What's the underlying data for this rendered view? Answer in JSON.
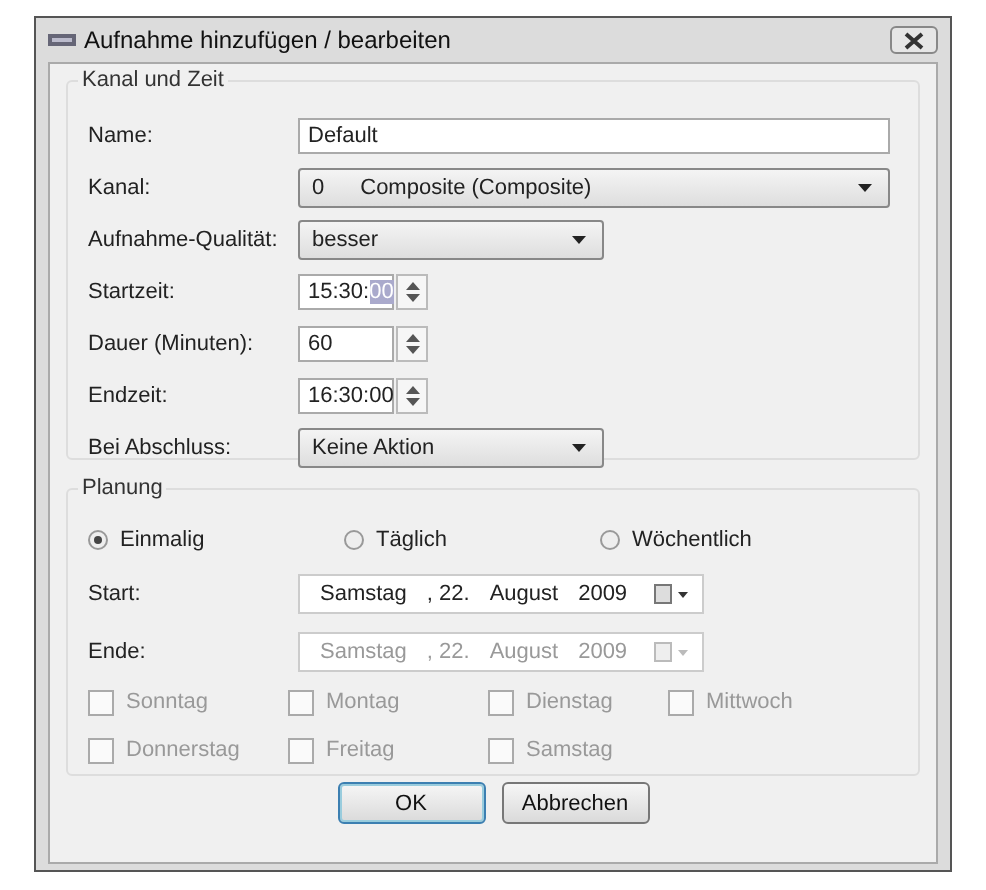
{
  "window": {
    "title": "Aufnahme hinzufügen / bearbeiten"
  },
  "channel_group": {
    "title": "Kanal und Zeit",
    "fields": [
      {
        "label": "Name:",
        "kind": "text",
        "value": "Default"
      },
      {
        "label": "Kanal:",
        "kind": "combo",
        "wide": true,
        "parts": [
          "0",
          "Composite  (Composite)"
        ]
      },
      {
        "label": "Aufnahme-Qualität:",
        "kind": "combo",
        "wide": false,
        "parts": [
          "besser"
        ]
      },
      {
        "label": "Startzeit:",
        "kind": "spin",
        "value": "15:30:",
        "highlighted": "00"
      },
      {
        "label": "Dauer (Minuten):",
        "kind": "spin",
        "value": "60"
      },
      {
        "label": "Endzeit:",
        "kind": "spin",
        "value": "16:30:00"
      },
      {
        "label": "Bei Abschluss:",
        "kind": "combo",
        "wide": false,
        "parts": [
          "Keine Aktion"
        ]
      }
    ]
  },
  "planning_group": {
    "title": "Planung",
    "modes": [
      {
        "label": "Einmalig",
        "selected": true
      },
      {
        "label": "Täglich",
        "selected": false
      },
      {
        "label": "Wöchentlich",
        "selected": false
      }
    ],
    "dates": [
      {
        "label": "Start:",
        "parts": [
          "Samstag",
          ", 22.",
          "August",
          "2009"
        ],
        "disabled": false
      },
      {
        "label": "Ende:",
        "parts": [
          "Samstag",
          ", 22.",
          "August",
          "2009"
        ],
        "disabled": true
      }
    ],
    "weekday_rows": [
      [
        {
          "label": "Sonntag",
          "checked": false,
          "disabled": true
        },
        {
          "label": "Montag",
          "checked": false,
          "disabled": true
        },
        {
          "label": "Dienstag",
          "checked": false,
          "disabled": true
        },
        {
          "label": "Mittwoch",
          "checked": false,
          "disabled": true
        }
      ],
      [
        {
          "label": "Donnerstag",
          "checked": false,
          "disabled": true
        },
        {
          "label": "Freitag",
          "checked": false,
          "disabled": true
        },
        {
          "label": "Samstag",
          "checked": false,
          "disabled": true
        }
      ]
    ]
  },
  "buttons": [
    {
      "label": "OK",
      "default": true
    },
    {
      "label": "Abbrechen",
      "default": false
    }
  ]
}
